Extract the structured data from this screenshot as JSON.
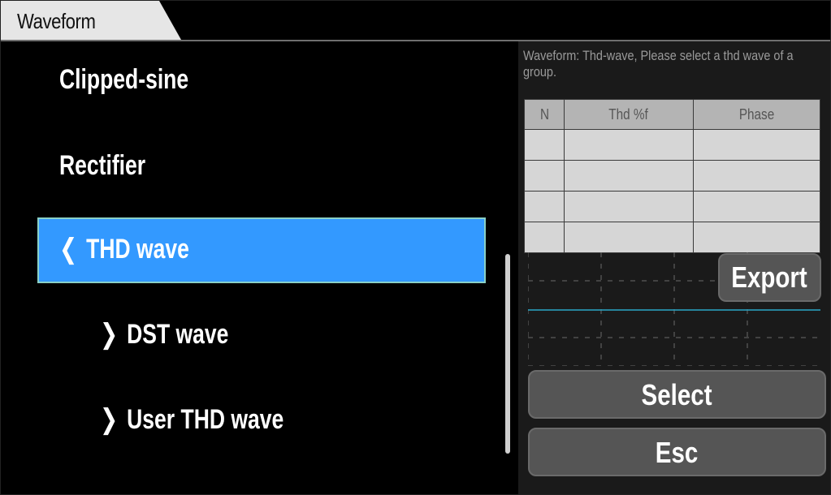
{
  "header": {
    "tab_title": "Waveform"
  },
  "menu": {
    "items": [
      {
        "label": "Clipped-sine",
        "chevron": ""
      },
      {
        "label": "Rectifier",
        "chevron": ""
      },
      {
        "label": "THD wave",
        "chevron": "❮"
      },
      {
        "label": "DST wave",
        "chevron": "❯"
      },
      {
        "label": "User THD wave",
        "chevron": "❯"
      }
    ],
    "selected_index": 2
  },
  "panel": {
    "info_text": "Waveform: Thd-wave, Please select a thd wave of a group.",
    "table": {
      "headers": [
        "N",
        "Thd  %f",
        "Phase"
      ],
      "rows": [
        [
          "",
          "",
          ""
        ],
        [
          "",
          "",
          ""
        ],
        [
          "",
          "",
          ""
        ],
        [
          "",
          "",
          ""
        ]
      ]
    },
    "buttons": {
      "export": "Export",
      "select": "Select",
      "esc": "Esc"
    }
  },
  "colors": {
    "selected_bg": "#3399ff",
    "trace": "#2aa8c8",
    "button_bg": "#555555"
  }
}
